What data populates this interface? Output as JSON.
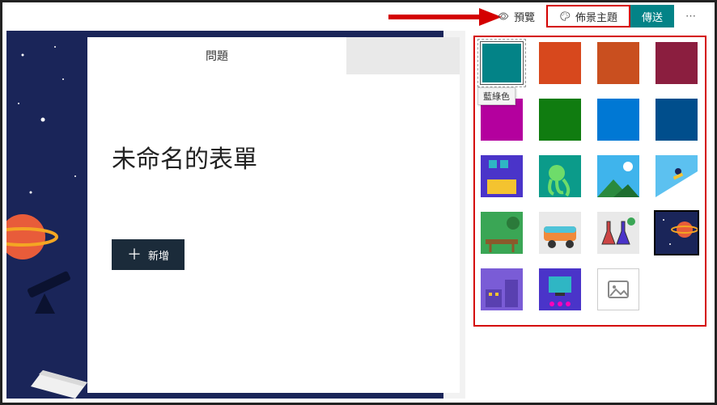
{
  "toolbar": {
    "preview_label": "預覽",
    "theme_label": "佈景主題",
    "send_label": "傳送",
    "more_label": "⋯"
  },
  "form": {
    "tab_questions": "問題",
    "title": "未命名的表單",
    "add_label": "新增"
  },
  "tooltip": "藍綠色",
  "theme": {
    "swatches": [
      {
        "name": "teal",
        "color": "#038387",
        "selected": true
      },
      {
        "name": "orange",
        "color": "#d7481d"
      },
      {
        "name": "rust",
        "color": "#c94f1f"
      },
      {
        "name": "crimson",
        "color": "#8b1e3f"
      },
      {
        "name": "magenta",
        "color": "#b4009e"
      },
      {
        "name": "green",
        "color": "#107c10"
      },
      {
        "name": "blue",
        "color": "#0078d4"
      },
      {
        "name": "navy",
        "color": "#004e8c"
      }
    ],
    "images": [
      {
        "name": "room"
      },
      {
        "name": "octopus"
      },
      {
        "name": "mountains"
      },
      {
        "name": "snowboard"
      },
      {
        "name": "park"
      },
      {
        "name": "van"
      },
      {
        "name": "flasks"
      },
      {
        "name": "space"
      },
      {
        "name": "office"
      },
      {
        "name": "tv"
      }
    ]
  }
}
